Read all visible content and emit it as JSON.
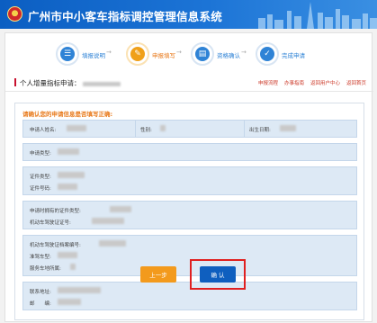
{
  "header": {
    "title": "广州市中小客车指标调控管理信息系统"
  },
  "steps": [
    {
      "label": "填报说明",
      "state": "done"
    },
    {
      "label": "申报填写",
      "state": "current"
    },
    {
      "label": "资格确认",
      "state": "todo"
    },
    {
      "label": "完成申请",
      "state": "todo"
    }
  ],
  "section": {
    "title": "个人增量指标申请："
  },
  "top_links": [
    "申报流程",
    "办事指南",
    "返回用户中心",
    "返回首页"
  ],
  "notice": "请确认您的申请信息是否填写正确:",
  "form": {
    "applicant_name_label": "申请人姓名:",
    "gender_label": "性别:",
    "birth_date_label": "出生日期:",
    "apply_type_label": "申请类型:",
    "id_type_label": "证件类型:",
    "id_number_label": "证件号码:",
    "app_id_type_label": "申请时拥有的证件类型:",
    "driver_license_label": "机动车驾驶证证号:",
    "vehicle_license_label": "机动车驾驶证档案编号:",
    "license_class_label": "准驾车型:",
    "service_area_label": "服务车地所属:",
    "address_label": "联系地址:",
    "postcode_label": "邮　　编:"
  },
  "buttons": {
    "prev": "上一步",
    "confirm": "确  认"
  },
  "colors": {
    "header_blue": "#0b5ec2",
    "step_done": "#2f83d6",
    "step_current": "#f0a018",
    "prev_button": "#f39a1c",
    "confirm_button": "#0f5fbf",
    "highlight_box": "#e02020",
    "notice": "#e8791a"
  }
}
